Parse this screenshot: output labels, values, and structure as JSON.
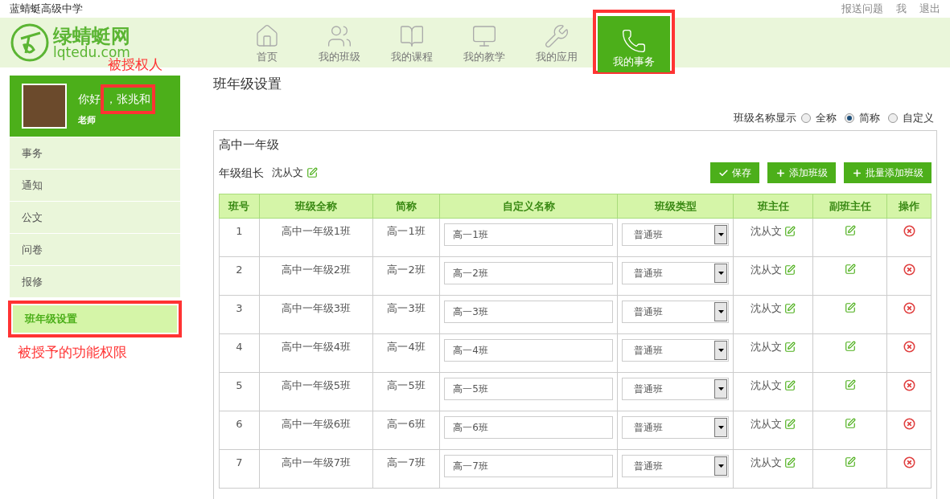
{
  "school": "蓝蜻蜓高级中学",
  "top_links": [
    "报送问题",
    "我",
    "退出"
  ],
  "logo": {
    "name": "绿蜻蜓网",
    "domain": "lqtedu.com"
  },
  "nav": [
    {
      "label": "首页",
      "selected": false,
      "highlighted": false
    },
    {
      "label": "我的班级",
      "selected": false,
      "highlighted": false
    },
    {
      "label": "我的课程",
      "selected": false,
      "highlighted": false
    },
    {
      "label": "我的教学",
      "selected": false,
      "highlighted": false
    },
    {
      "label": "我的应用",
      "selected": false,
      "highlighted": false
    },
    {
      "label": "我的事务",
      "selected": true,
      "highlighted": true
    }
  ],
  "annotations": {
    "grantee": "被授权人",
    "permission": "被授予的功能权限"
  },
  "profile": {
    "greeting": "你好",
    "name": "，张兆和",
    "name_highlighted": true,
    "role": "老师"
  },
  "sidebar": [
    {
      "label": "事务",
      "selected": false,
      "highlighted": false
    },
    {
      "label": "通知",
      "selected": false,
      "highlighted": false
    },
    {
      "label": "公文",
      "selected": false,
      "highlighted": false
    },
    {
      "label": "问卷",
      "selected": false,
      "highlighted": false
    },
    {
      "label": "报修",
      "selected": false,
      "highlighted": false
    },
    {
      "label": "班年级设置",
      "selected": true,
      "highlighted": true
    }
  ],
  "page_title": "班年级设置",
  "name_display": {
    "label": "班级名称显示",
    "options": [
      {
        "label": "全称",
        "selected": false
      },
      {
        "label": "简称",
        "selected": true
      },
      {
        "label": "自定义",
        "selected": false
      }
    ]
  },
  "grade": {
    "title": "高中一年级",
    "leader_label": "年级组长",
    "leader_name": "沈从文",
    "buttons": [
      {
        "label": "保存",
        "kind": "save"
      },
      {
        "label": "添加班级",
        "kind": "add"
      },
      {
        "label": "批量添加班级",
        "kind": "add"
      }
    ]
  },
  "table": {
    "columns": [
      "班号",
      "班级全称",
      "简称",
      "自定义名称",
      "班级类型",
      "班主任",
      "副班主任",
      "操作"
    ],
    "rows": [
      {
        "no": "1",
        "full_name": "高中一年级1班",
        "short_name": "高一1班",
        "custom_name": "高一1班",
        "type": "普通班",
        "head_teacher": "沈从文"
      },
      {
        "no": "2",
        "full_name": "高中一年级2班",
        "short_name": "高一2班",
        "custom_name": "高一2班",
        "type": "普通班",
        "head_teacher": "沈从文"
      },
      {
        "no": "3",
        "full_name": "高中一年级3班",
        "short_name": "高一3班",
        "custom_name": "高一3班",
        "type": "普通班",
        "head_teacher": "沈从文"
      },
      {
        "no": "4",
        "full_name": "高中一年级4班",
        "short_name": "高一4班",
        "custom_name": "高一4班",
        "type": "普通班",
        "head_teacher": "沈从文"
      },
      {
        "no": "5",
        "full_name": "高中一年级5班",
        "short_name": "高一5班",
        "custom_name": "高一5班",
        "type": "普通班",
        "head_teacher": "沈从文"
      },
      {
        "no": "6",
        "full_name": "高中一年级6班",
        "short_name": "高一6班",
        "custom_name": "高一6班",
        "type": "普通班",
        "head_teacher": "沈从文"
      },
      {
        "no": "7",
        "full_name": "高中一年级7班",
        "short_name": "高一7班",
        "custom_name": "高一7班",
        "type": "普通班",
        "head_teacher": "沈从文"
      }
    ]
  }
}
